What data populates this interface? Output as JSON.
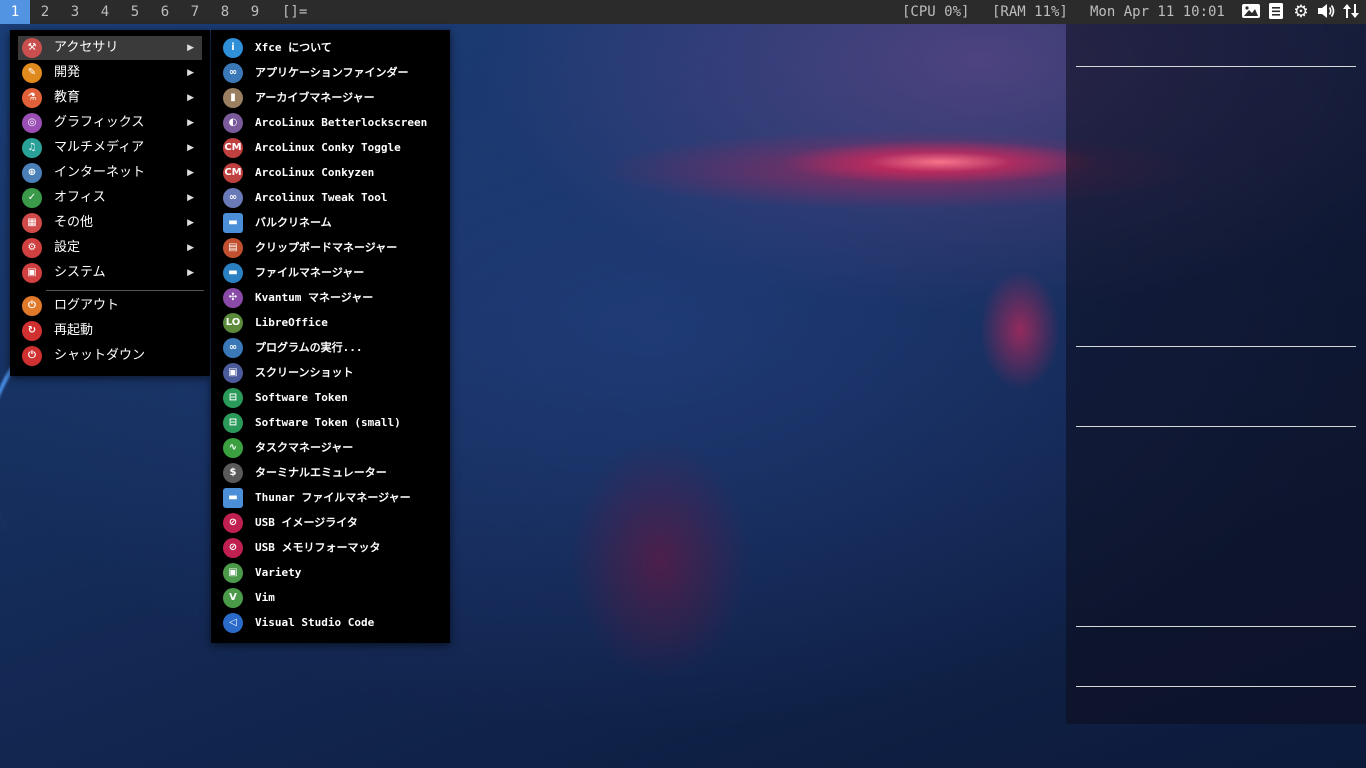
{
  "topbar": {
    "workspaces": [
      {
        "label": "1",
        "active": true
      },
      {
        "label": "2",
        "active": false
      },
      {
        "label": "3",
        "active": false
      },
      {
        "label": "4",
        "active": false
      },
      {
        "label": "5",
        "active": false
      },
      {
        "label": "6",
        "active": false
      },
      {
        "label": "7",
        "active": false
      },
      {
        "label": "8",
        "active": false
      },
      {
        "label": "9",
        "active": false
      }
    ],
    "layout_symbol": "[]=",
    "cpu": "[CPU 0%]",
    "ram": "[RAM 11%]",
    "datetime": "Mon Apr 11 10:01",
    "tray": [
      "screenshot-icon",
      "clipboard-icon",
      "settings-gear-icon",
      "volume-icon",
      "network-icon"
    ]
  },
  "main_menu": {
    "items": [
      {
        "label": "アクセサリ",
        "icon": "accessories-icon",
        "color": "#c94f4f",
        "has_submenu": true,
        "selected": true
      },
      {
        "label": "開発",
        "icon": "development-icon",
        "color": "#e08a1e",
        "has_submenu": true
      },
      {
        "label": "教育",
        "icon": "education-icon",
        "color": "#e0603a",
        "has_submenu": true
      },
      {
        "label": "グラフィックス",
        "icon": "graphics-icon",
        "color": "#9b4fb5",
        "has_submenu": true
      },
      {
        "label": "マルチメディア",
        "icon": "multimedia-icon",
        "color": "#2aa198",
        "has_submenu": true
      },
      {
        "label": "インターネット",
        "icon": "internet-icon",
        "color": "#4a7fb8",
        "has_submenu": true
      },
      {
        "label": "オフィス",
        "icon": "office-icon",
        "color": "#3a9a4a",
        "has_submenu": true
      },
      {
        "label": "その他",
        "icon": "other-icon",
        "color": "#d04a4a",
        "has_submenu": true
      },
      {
        "label": "設定",
        "icon": "settings-icon",
        "color": "#d04040",
        "has_submenu": true
      },
      {
        "label": "システム",
        "icon": "system-icon",
        "color": "#d04040",
        "has_submenu": true
      }
    ],
    "session": [
      {
        "label": "ログアウト",
        "icon": "logout-icon",
        "color": "#e07a2a"
      },
      {
        "label": "再起動",
        "icon": "restart-icon",
        "color": "#d03030"
      },
      {
        "label": "シャットダウン",
        "icon": "shutdown-icon",
        "color": "#d03030"
      }
    ]
  },
  "submenu": {
    "items": [
      {
        "label": "Xfce について",
        "icon": "info-icon",
        "color": "#2f8fd8",
        "glyph": "i"
      },
      {
        "label": "アプリケーションファインダー",
        "icon": "binoculars-icon",
        "color": "#3a78b8",
        "glyph": "∞"
      },
      {
        "label": "アーカイブマネージャー",
        "icon": "archive-icon",
        "color": "#9a8060",
        "glyph": "▮"
      },
      {
        "label": "ArcoLinux Betterlockscreen",
        "icon": "lockscreen-icon",
        "color": "#7a5a9a",
        "glyph": "◐"
      },
      {
        "label": "ArcoLinux Conky Toggle",
        "icon": "conky-icon",
        "color": "#c04040",
        "glyph": "CM"
      },
      {
        "label": "ArcoLinux Conkyzen",
        "icon": "conkyzen-icon",
        "color": "#c04040",
        "glyph": "CM"
      },
      {
        "label": "Arcolinux Tweak Tool",
        "icon": "tweak-tool-icon",
        "color": "#6a7ab8",
        "glyph": "∞"
      },
      {
        "label": "バルクリネーム",
        "icon": "folder-icon",
        "color": "#4a8fd8",
        "glyph": "▬"
      },
      {
        "label": "クリップボードマネージャー",
        "icon": "clipboard-manager-icon",
        "color": "#c05030",
        "glyph": "▤"
      },
      {
        "label": "ファイルマネージャー",
        "icon": "file-manager-icon",
        "color": "#2a80c0",
        "glyph": "▬"
      },
      {
        "label": "Kvantum マネージャー",
        "icon": "kvantum-icon",
        "color": "#8a4aa8",
        "glyph": "✣"
      },
      {
        "label": "LibreOffice",
        "icon": "libreoffice-icon",
        "color": "#5a8a3a",
        "glyph": "LO"
      },
      {
        "label": "プログラムの実行...",
        "icon": "run-program-icon",
        "color": "#3a78b8",
        "glyph": "∞"
      },
      {
        "label": "スクリーンショット",
        "icon": "screenshot-tool-icon",
        "color": "#4a5a9a",
        "glyph": "▣"
      },
      {
        "label": "Software Token",
        "icon": "token-icon",
        "color": "#2a9a5a",
        "glyph": "⊟"
      },
      {
        "label": "Software Token (small)",
        "icon": "token-small-icon",
        "color": "#2a9a5a",
        "glyph": "⊟"
      },
      {
        "label": "タスクマネージャー",
        "icon": "task-manager-icon",
        "color": "#3aa040",
        "glyph": "∿"
      },
      {
        "label": "ターミナルエミュレーター",
        "icon": "terminal-icon",
        "color": "#5a5a5a",
        "glyph": "$"
      },
      {
        "label": "Thunar ファイルマネージャー",
        "icon": "thunar-icon",
        "color": "#4a8fd8",
        "glyph": "▬"
      },
      {
        "label": "USB イメージライタ",
        "icon": "usb-writer-icon",
        "color": "#c02050",
        "glyph": "⊘"
      },
      {
        "label": "USB メモリフォーマッタ",
        "icon": "usb-formatter-icon",
        "color": "#c02050",
        "glyph": "⊘"
      },
      {
        "label": "Variety",
        "icon": "variety-icon",
        "color": "#4a9a4a",
        "glyph": "▣"
      },
      {
        "label": "Vim",
        "icon": "vim-icon",
        "color": "#4a9a4a",
        "glyph": "V"
      },
      {
        "label": "Visual Studio Code",
        "icon": "vscode-icon",
        "color": "#2a6ac8",
        "glyph": "◁"
      }
    ]
  }
}
